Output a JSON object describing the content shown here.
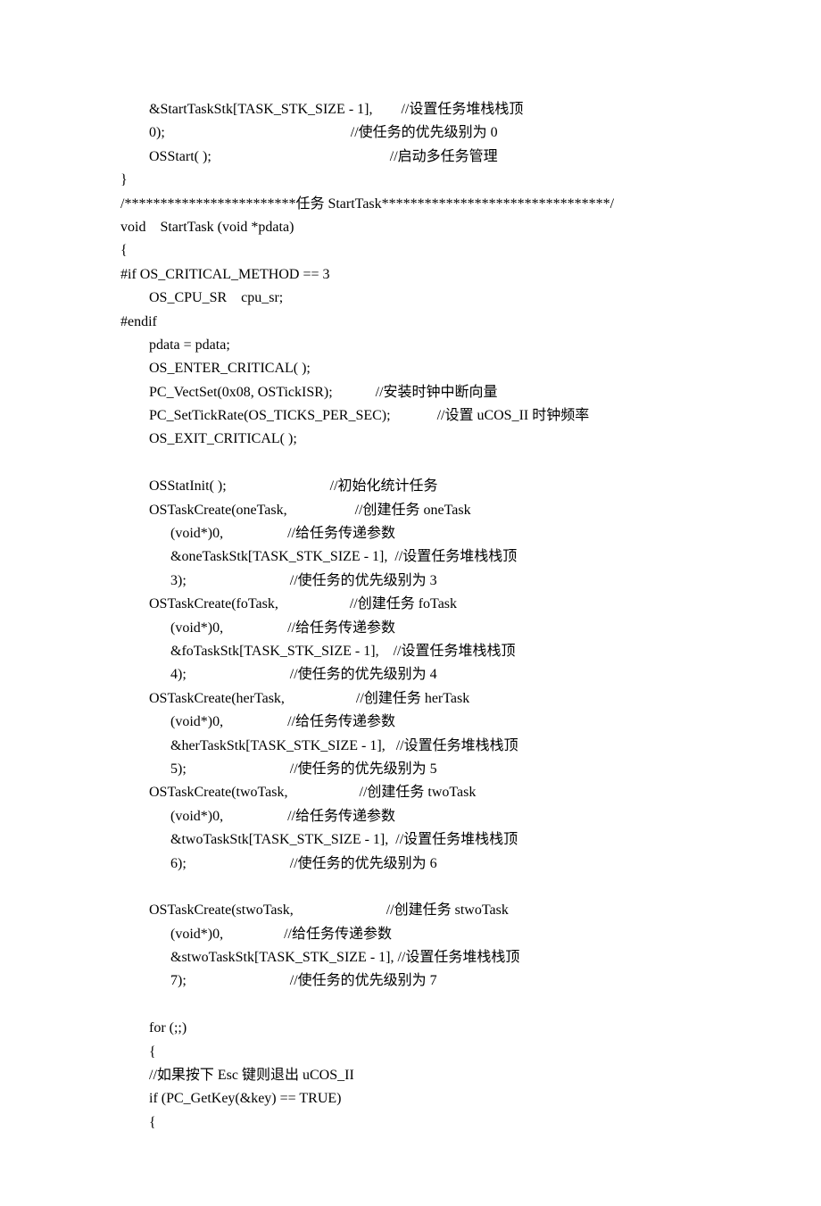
{
  "lines": [
    "        &StartTaskStk[TASK_STK_SIZE - 1],        //设置任务堆栈栈顶",
    "        0);                                                    //使任务的优先级别为 0",
    "        OSStart( );                                                  //启动多任务管理",
    "}",
    "/************************任务 StartTask********************************/",
    "void    StartTask (void *pdata)",
    "{",
    "#if OS_CRITICAL_METHOD == 3",
    "        OS_CPU_SR    cpu_sr;",
    "#endif",
    "        pdata = pdata;",
    "        OS_ENTER_CRITICAL( );",
    "        PC_VectSet(0x08, OSTickISR);            //安装时钟中断向量",
    "        PC_SetTickRate(OS_TICKS_PER_SEC);             //设置 uCOS_II 时钟频率",
    "        OS_EXIT_CRITICAL( );",
    "",
    "        OSStatInit( );                             //初始化统计任务",
    "        OSTaskCreate(oneTask,                   //创建任务 oneTask",
    "              (void*)0,                  //给任务传递参数",
    "              &oneTaskStk[TASK_STK_SIZE - 1],  //设置任务堆栈栈顶",
    "              3);                             //使任务的优先级别为 3",
    "        OSTaskCreate(foTask,                    //创建任务 foTask",
    "              (void*)0,                  //给任务传递参数",
    "              &foTaskStk[TASK_STK_SIZE - 1],    //设置任务堆栈栈顶",
    "              4);                             //使任务的优先级别为 4",
    "        OSTaskCreate(herTask,                    //创建任务 herTask",
    "              (void*)0,                  //给任务传递参数",
    "              &herTaskStk[TASK_STK_SIZE - 1],   //设置任务堆栈栈顶",
    "              5);                             //使任务的优先级别为 5",
    "        OSTaskCreate(twoTask,                    //创建任务 twoTask",
    "              (void*)0,                  //给任务传递参数",
    "              &twoTaskStk[TASK_STK_SIZE - 1],  //设置任务堆栈栈顶",
    "              6);                             //使任务的优先级别为 6",
    "",
    "        OSTaskCreate(stwoTask,                          //创建任务 stwoTask",
    "              (void*)0,                 //给任务传递参数",
    "              &stwoTaskStk[TASK_STK_SIZE - 1], //设置任务堆栈栈顶",
    "              7);                             //使任务的优先级别为 7",
    "",
    "        for (;;)",
    "        {",
    "        //如果按下 Esc 键则退出 uCOS_II",
    "        if (PC_GetKey(&key) == TRUE)",
    "        {"
  ]
}
